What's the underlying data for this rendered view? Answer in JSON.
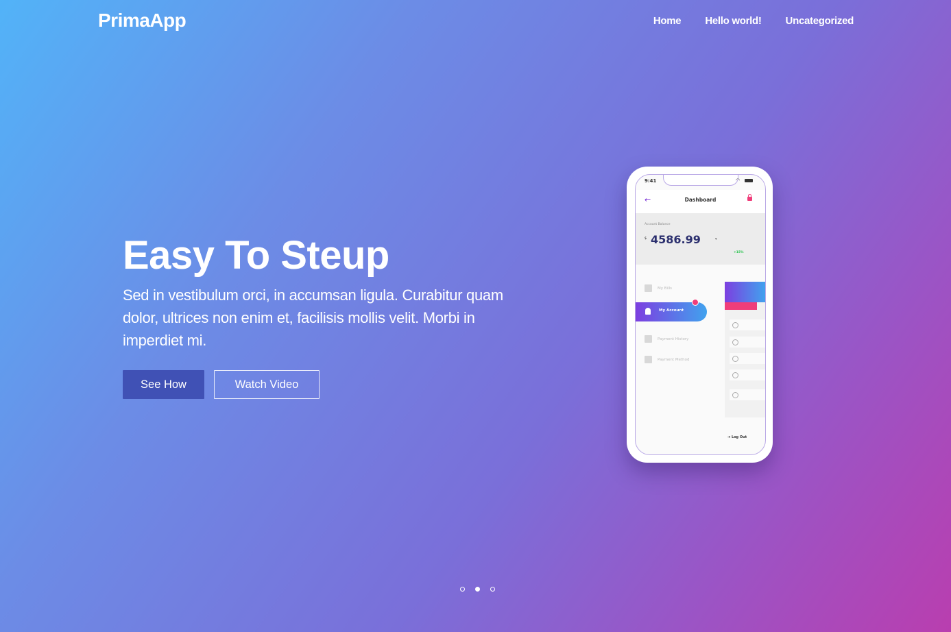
{
  "brand": {
    "logo": "PrimaApp"
  },
  "nav": {
    "items": [
      "Home",
      "Hello world!",
      "Uncategorized"
    ]
  },
  "hero": {
    "title": "Easy To Steup",
    "text": "Sed in vestibulum orci, in accumsan ligula. Curabitur quam dolor, ultrices non enim et, facilisis mollis velit. Morbi in imperdiet mi.",
    "buttons": {
      "primary": "See How",
      "secondary": "Watch Video"
    }
  },
  "phone": {
    "status_time": "9:41",
    "title": "Dashboard",
    "balance_label": "Account Balance",
    "currency": "$",
    "balance": "4586.99",
    "change": "+15%",
    "menu": [
      "My Bills",
      "My Account",
      "Payment History",
      "Payment Method"
    ],
    "logout": "Log Out"
  },
  "slider": {
    "count": 3,
    "active_index": 1
  },
  "colors": {
    "gradient_start": "#52b3f8",
    "gradient_end": "#b93eaf",
    "primary_button": "#4051b5"
  }
}
